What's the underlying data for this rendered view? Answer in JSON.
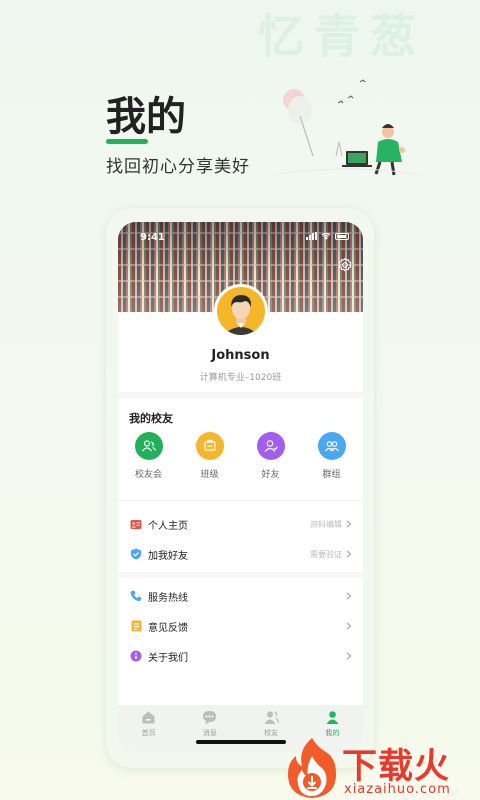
{
  "watermark_brand": "忆青葱",
  "hero": {
    "title": "我的",
    "subtitle": "找回初心分享美好"
  },
  "status_bar": {
    "time": "9:41"
  },
  "profile": {
    "name": "Johnson",
    "major": "计算机专业–1020班"
  },
  "friends_section": {
    "title": "我的校友",
    "items": [
      {
        "label": "校友会",
        "color": "#22b05a",
        "icon": "alumni-icon"
      },
      {
        "label": "班级",
        "color": "#f5b62e",
        "icon": "class-icon"
      },
      {
        "label": "好友",
        "color": "#a15ef0",
        "icon": "friend-icon"
      },
      {
        "label": "群组",
        "color": "#4aa7f4",
        "icon": "group-icon"
      }
    ]
  },
  "menu": [
    {
      "label": "个人主页",
      "hint": "资料编辑",
      "color": "#e8544b",
      "icon": "profile-card-icon"
    },
    {
      "label": "加我好友",
      "hint": "需要验证",
      "color": "#4aa7f4",
      "icon": "shield-check-icon"
    },
    {
      "label": "服务热线",
      "hint": "",
      "color": "#4aa7f4",
      "icon": "phone-icon"
    },
    {
      "label": "意见反馈",
      "hint": "",
      "color": "#f5b62e",
      "icon": "feedback-icon"
    },
    {
      "label": "关于我们",
      "hint": "",
      "color": "#a15ef0",
      "icon": "info-icon"
    }
  ],
  "tabs": [
    {
      "label": "首页",
      "active": false,
      "icon": "home-icon"
    },
    {
      "label": "消息",
      "active": false,
      "icon": "message-icon"
    },
    {
      "label": "校友",
      "active": false,
      "icon": "alumni-tab-icon"
    },
    {
      "label": "我的",
      "active": true,
      "icon": "user-icon"
    }
  ],
  "accent_color": "#21b35b",
  "watermark_site": {
    "name": "下载火",
    "url": "xiazaihuo.com"
  }
}
